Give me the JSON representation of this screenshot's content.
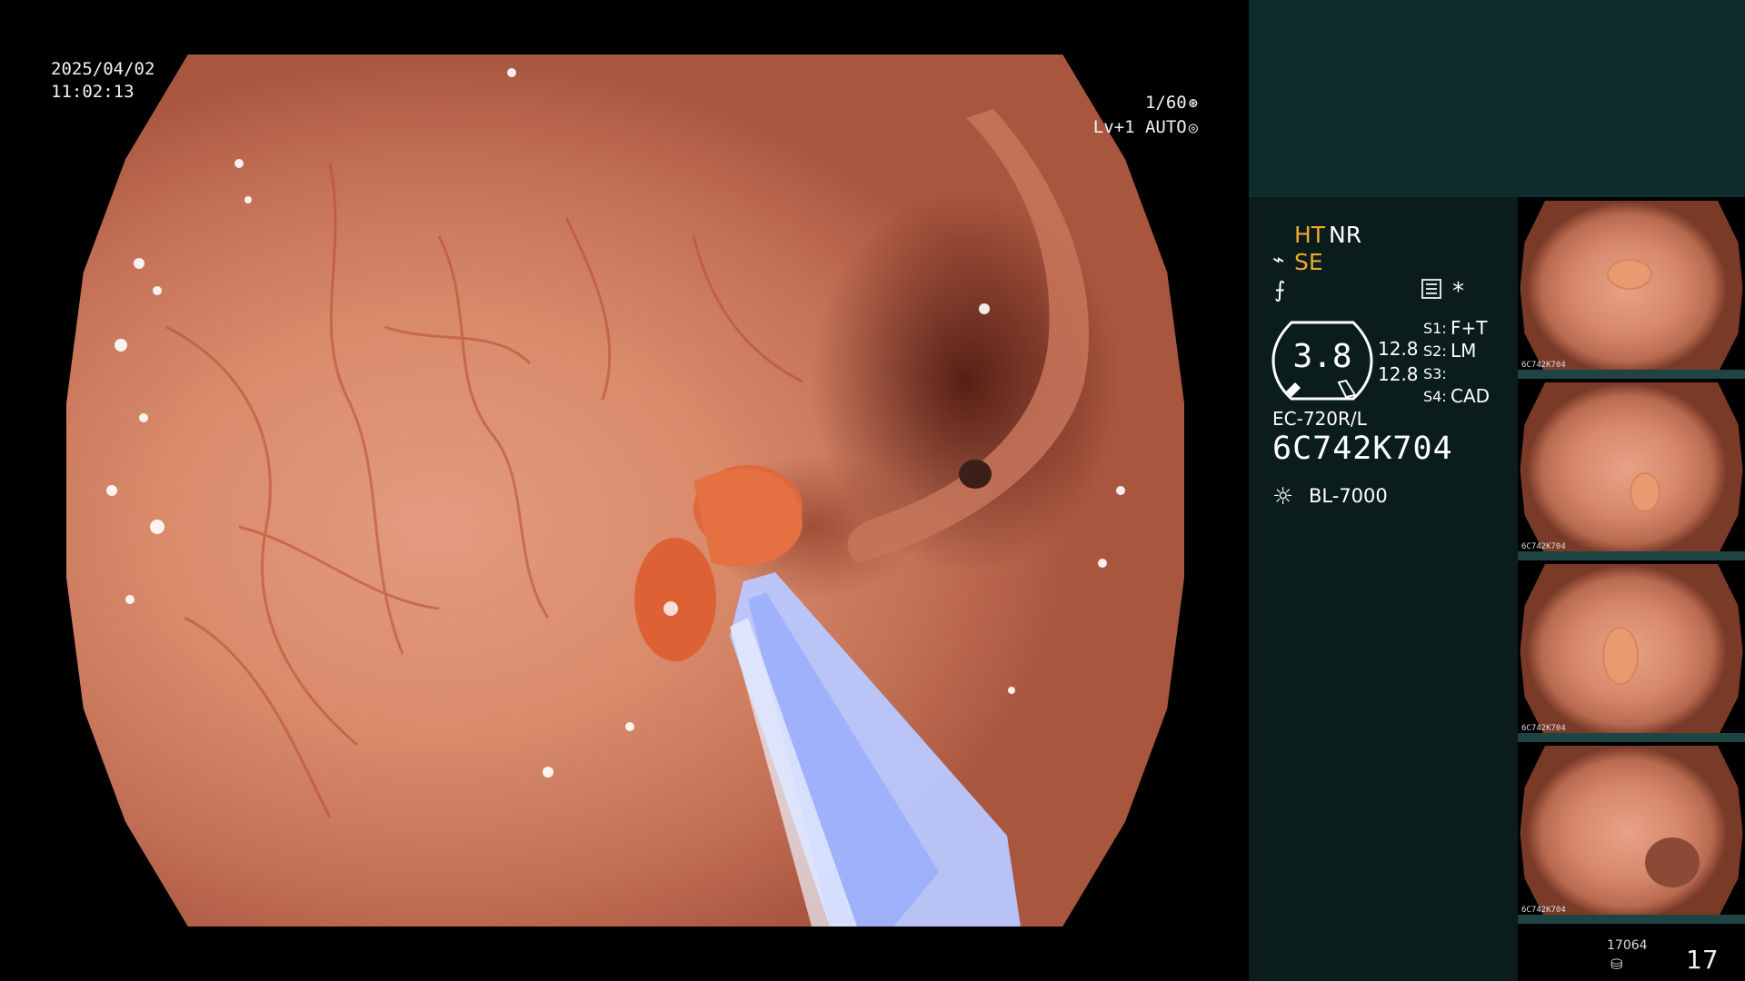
{
  "overlay": {
    "date": "2025/04/02",
    "time": "11:02:13",
    "shutter": "1/60",
    "shutter_icon": "⊛",
    "level": "Lv+1 AUTO",
    "level_icon": "◎"
  },
  "panel": {
    "ht": "HT",
    "nr": "NR",
    "se": "SE",
    "gauge_value": "3.8",
    "value_a": "12.8",
    "value_b": "12.8",
    "s1_label": "S1:",
    "s1_value": "F+T",
    "s2_label": "S2:",
    "s2_value": "LM",
    "s3_label": "S3:",
    "s3_value": "",
    "s4_label": "S4:",
    "s4_value": "CAD",
    "scope_model": "EC-720R/L",
    "scope_serial": "6C742K704",
    "light_source": "BL-7000",
    "star": "*"
  },
  "thumbnails": [
    {
      "serial": "6C742K704"
    },
    {
      "serial": "6C742K704"
    },
    {
      "serial": "6C742K704"
    },
    {
      "serial": "6C742K704"
    }
  ],
  "footer": {
    "count_small": "17064",
    "count_big": "17"
  },
  "colors": {
    "accent": "#f0a830",
    "panel_bg": "#0a1c1c",
    "teal_box": "#0e2c2c"
  }
}
